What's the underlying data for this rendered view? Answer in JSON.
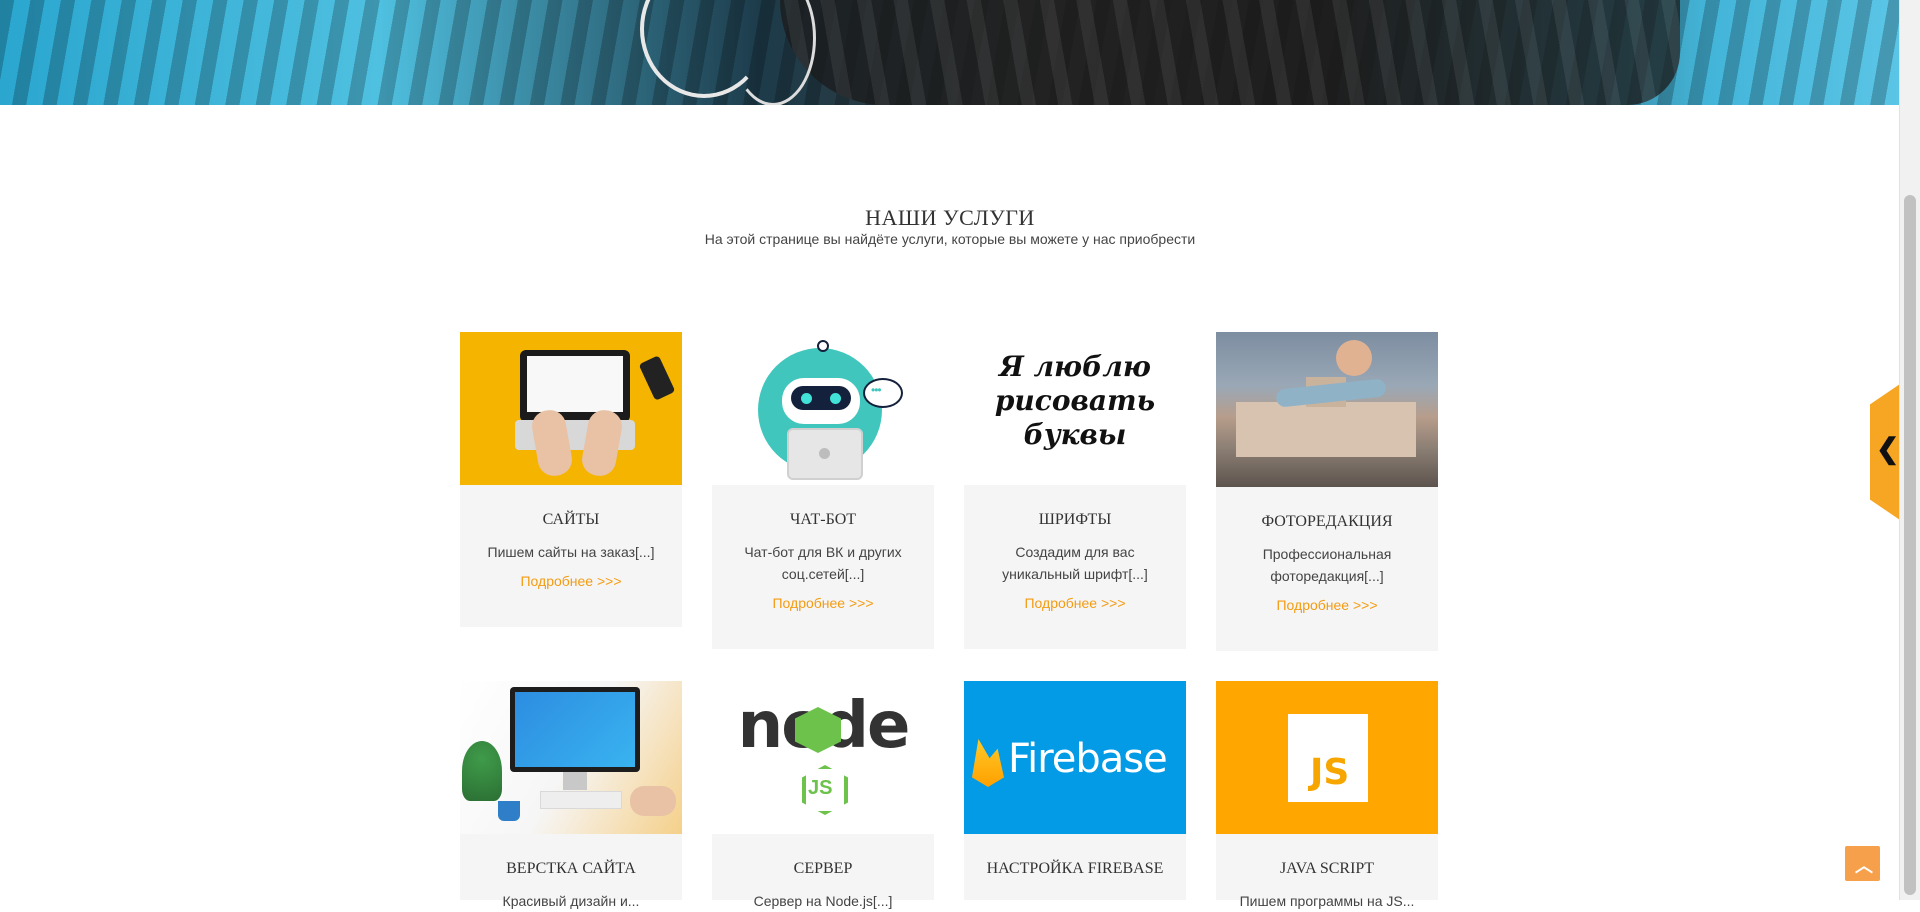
{
  "section": {
    "title": "НАШИ УСЛУГИ",
    "subtitle": "На этой странице вы найдёте услуги, которые вы можете у нас приобрести"
  },
  "cards": [
    {
      "title": "САЙТЫ",
      "desc": "Пишем сайты на заказ[...]",
      "more": "Подробнее >>>"
    },
    {
      "title": "ЧАТ-БОТ",
      "desc": "Чат-бот для ВК и других соц.сетей[...]",
      "more": "Подробнее >>>"
    },
    {
      "title": "ШРИФТЫ",
      "desc": "Создадим для вас уникальный шрифт[...]",
      "more": "Подробнее >>>"
    },
    {
      "title": "ФОТОРЕДАКЦИЯ",
      "desc": "Профессиональная фоторедакция[...]",
      "more": "Подробнее >>>"
    },
    {
      "title": "ВЕРСТКА САЙТА",
      "desc": "Красивый дизайн и...",
      "more": ""
    },
    {
      "title": "СЕРВЕР",
      "desc": "Сервер на Node.js[...]",
      "more": ""
    },
    {
      "title": "НАСТРОЙКА FIREBASE",
      "desc": "",
      "more": ""
    },
    {
      "title": "JAVA SCRIPT",
      "desc": "Пишем программы на JS...",
      "more": ""
    }
  ],
  "images": {
    "fonts_art": "Я люблю рисовать буквы",
    "node_word": "node",
    "node_js": "JS",
    "firebase_text": "Firebase",
    "js_badge": "JS"
  },
  "icons": {
    "side_tab": "chevron-left-icon",
    "to_top": "chevron-up-icon"
  },
  "colors": {
    "accent": "#f39c12",
    "card_bg": "#f5f5f5",
    "firebase_bg": "#039be5",
    "js_bg": "#ffa600"
  }
}
